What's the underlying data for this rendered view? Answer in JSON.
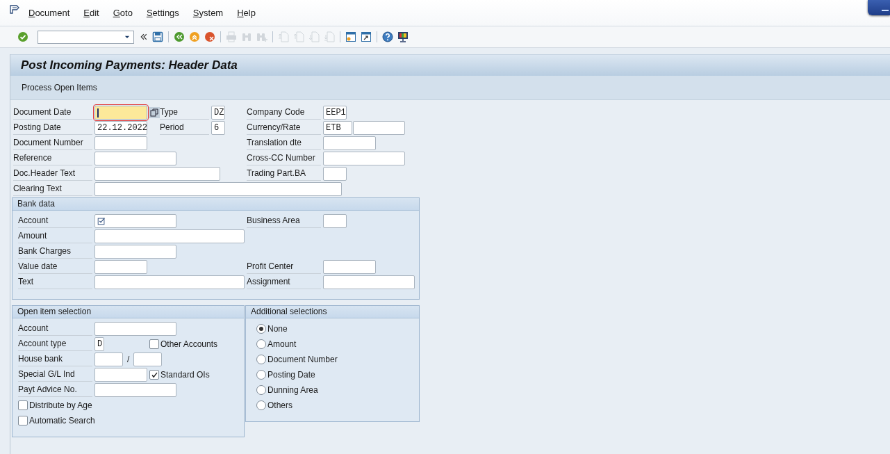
{
  "menu_bar": {
    "items": [
      "Document",
      "Edit",
      "Goto",
      "Settings",
      "System",
      "Help"
    ]
  },
  "toolbar": {
    "buttons": [
      {
        "disabled": false
      },
      {
        "disabled": false
      },
      {
        "disabled": false
      },
      {
        "disabled": false
      },
      {
        "disabled": false
      },
      {
        "disabled": true
      },
      {
        "disabled": true
      },
      {
        "disabled": true
      },
      {
        "disabled": true
      },
      {
        "disabled": true
      },
      {
        "disabled": true
      },
      {
        "disabled": true
      },
      {
        "disabled": false
      },
      {
        "disabled": false
      },
      {
        "disabled": false
      },
      {
        "disabled": false
      }
    ]
  },
  "title": "Post Incoming Payments: Header Data",
  "app_toolbar": {
    "buttons": [
      "Process Open Items"
    ]
  },
  "header": {
    "rows": [
      {
        "left": {
          "label": "Document Date",
          "focused": true
        },
        "middle": {
          "label": "Type",
          "value": "DZ"
        },
        "right": {
          "label": "Company Code",
          "value": "EEP1"
        }
      },
      {
        "left": {
          "label": "Posting Date",
          "value": "22.12.2022",
          "focused": false
        },
        "middle": {
          "label": "Period",
          "value": "6"
        },
        "right": {
          "label": "Currency/Rate",
          "value": "ETB",
          "second_field": true
        }
      },
      {
        "left": {
          "label": "Document Number",
          "focused": false
        },
        "right": {
          "label": "Translation dte"
        }
      },
      {
        "left": {
          "label": "Reference",
          "focused": false
        },
        "right": {
          "label": "Cross-CC Number"
        }
      },
      {
        "left": {
          "label": "Doc.Header Text",
          "focused": false
        },
        "right": {
          "label": "Trading Part.BA"
        }
      },
      {
        "left": {
          "label": "Clearing Text",
          "focused": false
        }
      }
    ]
  },
  "bank_data": {
    "title": "Bank data",
    "rows": [
      {
        "left": {
          "label": "Account",
          "required": true
        },
        "right": {
          "label": "Business Area"
        }
      },
      {
        "left": {
          "label": "Amount",
          "required": false
        }
      },
      {
        "left": {
          "label": "Bank Charges",
          "required": false
        }
      },
      {
        "left": {
          "label": "Value date",
          "required": false
        },
        "right": {
          "label": "Profit Center"
        }
      },
      {
        "left": {
          "label": "Text",
          "required": false
        },
        "right": {
          "label": "Assignment"
        }
      }
    ]
  },
  "open_item_selection": {
    "title": "Open item selection",
    "rows": [
      {
        "kind": "field",
        "label": "Account"
      },
      {
        "kind": "field_checkbox",
        "label": "Account type",
        "value": "D",
        "checkbox": {
          "label": "Other Accounts",
          "checked": false
        }
      },
      {
        "kind": "field_pair",
        "label": "House bank",
        "separator": "/"
      },
      {
        "kind": "field_checkbox",
        "label": "Special G/L Ind",
        "checkbox": {
          "label": "Standard OIs",
          "checked": true
        }
      },
      {
        "kind": "field",
        "label": "Payt Advice No."
      },
      {
        "kind": "checkbox",
        "label": "Distribute by Age",
        "checked": false
      },
      {
        "kind": "checkbox",
        "label": "Automatic Search",
        "checked": false
      }
    ]
  },
  "additional_selections": {
    "title": "Additional selections",
    "options": [
      {
        "label": "None",
        "selected": true
      },
      {
        "label": "Amount",
        "selected": false
      },
      {
        "label": "Document Number",
        "selected": false
      },
      {
        "label": "Posting Date",
        "selected": false
      },
      {
        "label": "Dunning Area",
        "selected": false
      },
      {
        "label": "Others",
        "selected": false
      }
    ]
  }
}
